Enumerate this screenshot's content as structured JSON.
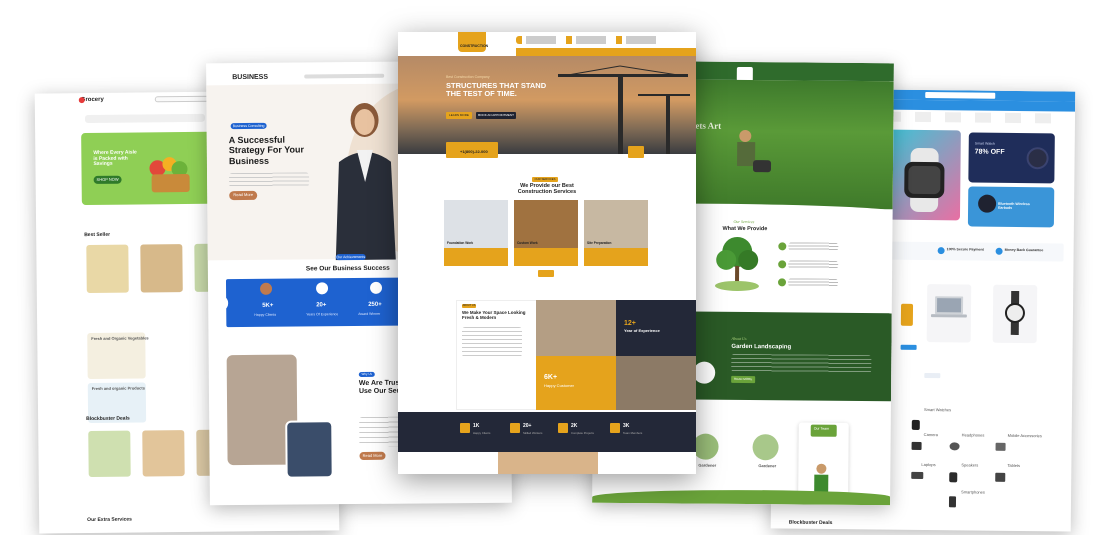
{
  "grocery": {
    "logo": "Grocery",
    "hero_title": "Where Every Aisle is Packed with Savings",
    "hero_button": "SHOP NOW",
    "section_best": "Best Seller",
    "section_deals": "Blockbuster Deals",
    "section_services": "Our Extra Services",
    "promo1": "Fresh and Organic Vegetables",
    "promo2": "Fresh and organic Products",
    "promo_button": "SHOP NOW"
  },
  "business": {
    "logo": "BUSINESS",
    "badge": "Business Consulting",
    "hero_title": "A Successful Strategy For Your Business",
    "hero_button": "Read More",
    "success_badge": "Our Achievements",
    "success_title": "See Our Business Success",
    "stats": [
      {
        "value": "5K+",
        "label": "Happy Clients"
      },
      {
        "value": "20+",
        "label": "Years Of Experience"
      },
      {
        "value": "250+",
        "label": "Award Winner"
      }
    ],
    "why_badge": "Why Us",
    "why_title": "We Are Trust To Use Our Services",
    "why_button": "Read More"
  },
  "construction": {
    "logo": "CONSTRUCTION",
    "hero_small": "Best Construction Company",
    "hero_title": "STRUCTURES THAT STAND THE TEST OF TIME.",
    "btn_primary": "LEARN MORE",
    "btn_secondary": "BOOK AN APPOINTMENT",
    "phone": "+1(800)-22-000",
    "services_badge": "OUR SERVICES",
    "services_title": "We Provide our Best Construction Services",
    "services": [
      "Foundation Work",
      "Custom Work",
      "Site Preparation"
    ],
    "about_badge": "ABOUT US",
    "about_title": "We Make Your Space Looking Fresh & Modern",
    "years": "12+",
    "years_label": "Year of Experience",
    "happy": "6K+",
    "happy_label": "Happy Customer",
    "counters": [
      {
        "value": "1K",
        "label": "Happy Clients"
      },
      {
        "value": "20+",
        "label": "Skilled Workers"
      },
      {
        "value": "2K",
        "label": "Complete Projects"
      },
      {
        "value": "3K",
        "label": "Team Members"
      }
    ]
  },
  "garden": {
    "hero_text": "eets Art",
    "provide_small": "Our Services",
    "provide_title": "What We Provide",
    "landscape_small": "About Us",
    "landscape_title": "Garden Landscaping",
    "landscape_button": "READ MORE",
    "team_badge": "Our Team",
    "team": [
      "Gardener",
      "Gardener"
    ]
  },
  "electronics": {
    "banner_discount": "78% OFF",
    "banner_label": "Smart Watch",
    "earbuds_title": "Bluetooth Wireless Earbuds",
    "features": [
      "100% Secure Payment",
      "Money Back Guarantee"
    ],
    "section_deals": "Blockbuster Deals",
    "categories": [
      "Smart Watches",
      "Camera",
      "Headphones",
      "Laptops",
      "Speakers",
      "Smartphones",
      "Mobile Accessories",
      "Tablets"
    ]
  },
  "colors": {
    "grocery_green": "#7bc043",
    "business_blue": "#1e62d0",
    "business_orange": "#c07a4d",
    "construction_yellow": "#e5a31c",
    "construction_dark": "#232838",
    "garden_green": "#2f6b2c",
    "electronics_blue": "#2b8fe0",
    "electronics_navy": "#1f2d5a"
  }
}
